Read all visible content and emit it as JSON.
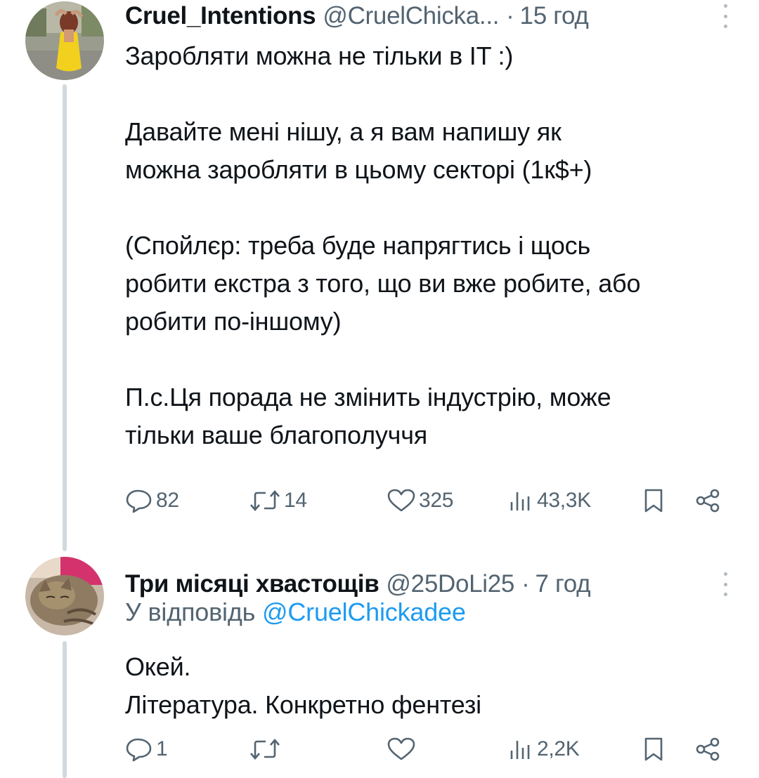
{
  "tweets": [
    {
      "display_name": "Cruel_Intentions",
      "handle": "@CruelChicka...",
      "separator": "·",
      "time": "15 год",
      "text": "Заробляти можна не тільки в IT :)\n\nДавайте мені нішу, а я вам напишу як\nможна заробляти в цьому секторі (1к$+)\n\n(Спойлєр: треба буде напрягтись і щось\nробити екстра з того, що ви вже робите, або\nробити по-іншому)\n\nП.с.Ця порада не змінить індустрію, може\nтільки ваше благополуччя",
      "stats": {
        "replies": "82",
        "retweets": "14",
        "likes": "325",
        "views": "43,3K"
      }
    },
    {
      "display_name": "Три місяці хвастощів",
      "handle": "@25DoLi25",
      "separator": "·",
      "time": "7 год",
      "reply_prefix": "У відповідь",
      "reply_mention": "@CruelChickadee",
      "text": "Окей.\nЛітература. Конкретно фентезі",
      "stats": {
        "replies": "1",
        "retweets": "",
        "likes": "",
        "views": "2,2K"
      }
    }
  ],
  "colors": {
    "text": "#0f1419",
    "secondary": "#536471",
    "link": "#1d9bf0",
    "thread_line": "#cfd9de"
  },
  "icons": [
    "reply-icon",
    "retweet-icon",
    "like-icon",
    "views-icon",
    "bookmark-icon",
    "share-icon",
    "more-icon"
  ]
}
